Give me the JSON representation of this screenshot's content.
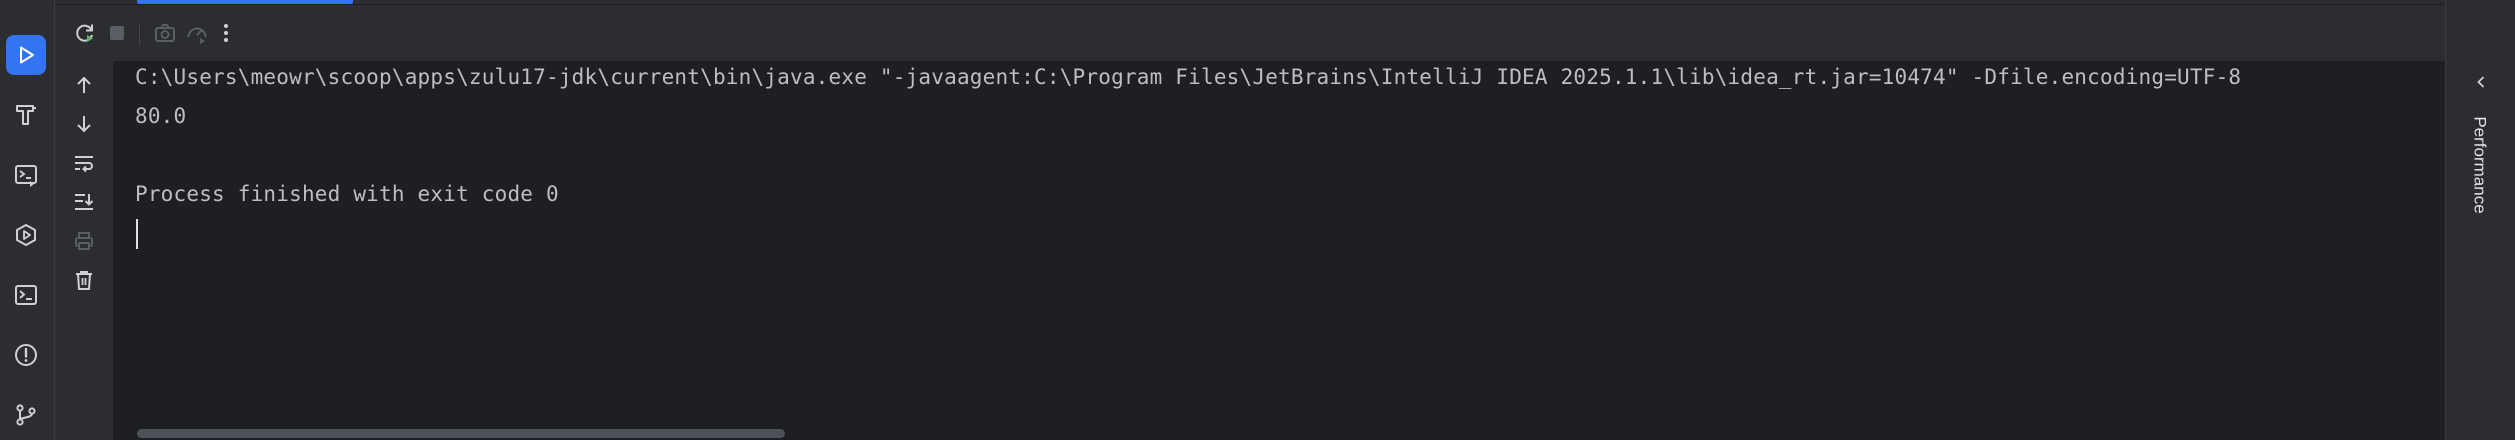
{
  "left_toolbar": {
    "items": [
      {
        "icon": "run-icon",
        "active": true
      },
      {
        "icon": "build-hammer-icon"
      },
      {
        "icon": "run-console-icon"
      },
      {
        "icon": "services-icon"
      },
      {
        "icon": "terminal-icon"
      },
      {
        "icon": "problems-icon"
      },
      {
        "icon": "git-icon"
      }
    ]
  },
  "run_toolbar": {
    "buttons": [
      {
        "icon": "rerun-icon"
      },
      {
        "icon": "stop-icon"
      },
      {
        "icon": "screenshot-camera-icon"
      },
      {
        "icon": "profiler-gauge-icon"
      },
      {
        "icon": "more-vertical-icon"
      }
    ]
  },
  "console_toolbar": {
    "buttons": [
      {
        "icon": "arrow-up-icon"
      },
      {
        "icon": "arrow-down-icon"
      },
      {
        "icon": "soft-wrap-icon"
      },
      {
        "icon": "scroll-to-end-icon"
      },
      {
        "icon": "print-icon"
      },
      {
        "icon": "trash-icon"
      }
    ]
  },
  "console": {
    "lines": [
      "C:\\Users\\meowr\\scoop\\apps\\zulu17-jdk\\current\\bin\\java.exe \"-javaagent:C:\\Program Files\\JetBrains\\IntelliJ IDEA 2025.1.1\\lib\\idea_rt.jar=10474\" -Dfile.encoding=UTF-8",
      "80.0",
      "",
      "Process finished with exit code 0"
    ]
  },
  "right_panel": {
    "label": "Performance"
  },
  "colors": {
    "background": "#1e1f22",
    "panel": "#2b2d30",
    "accent": "#3574f0",
    "text": "#bcbec4",
    "icon": "#ced0d6",
    "icon_disabled": "#5a5d63"
  }
}
